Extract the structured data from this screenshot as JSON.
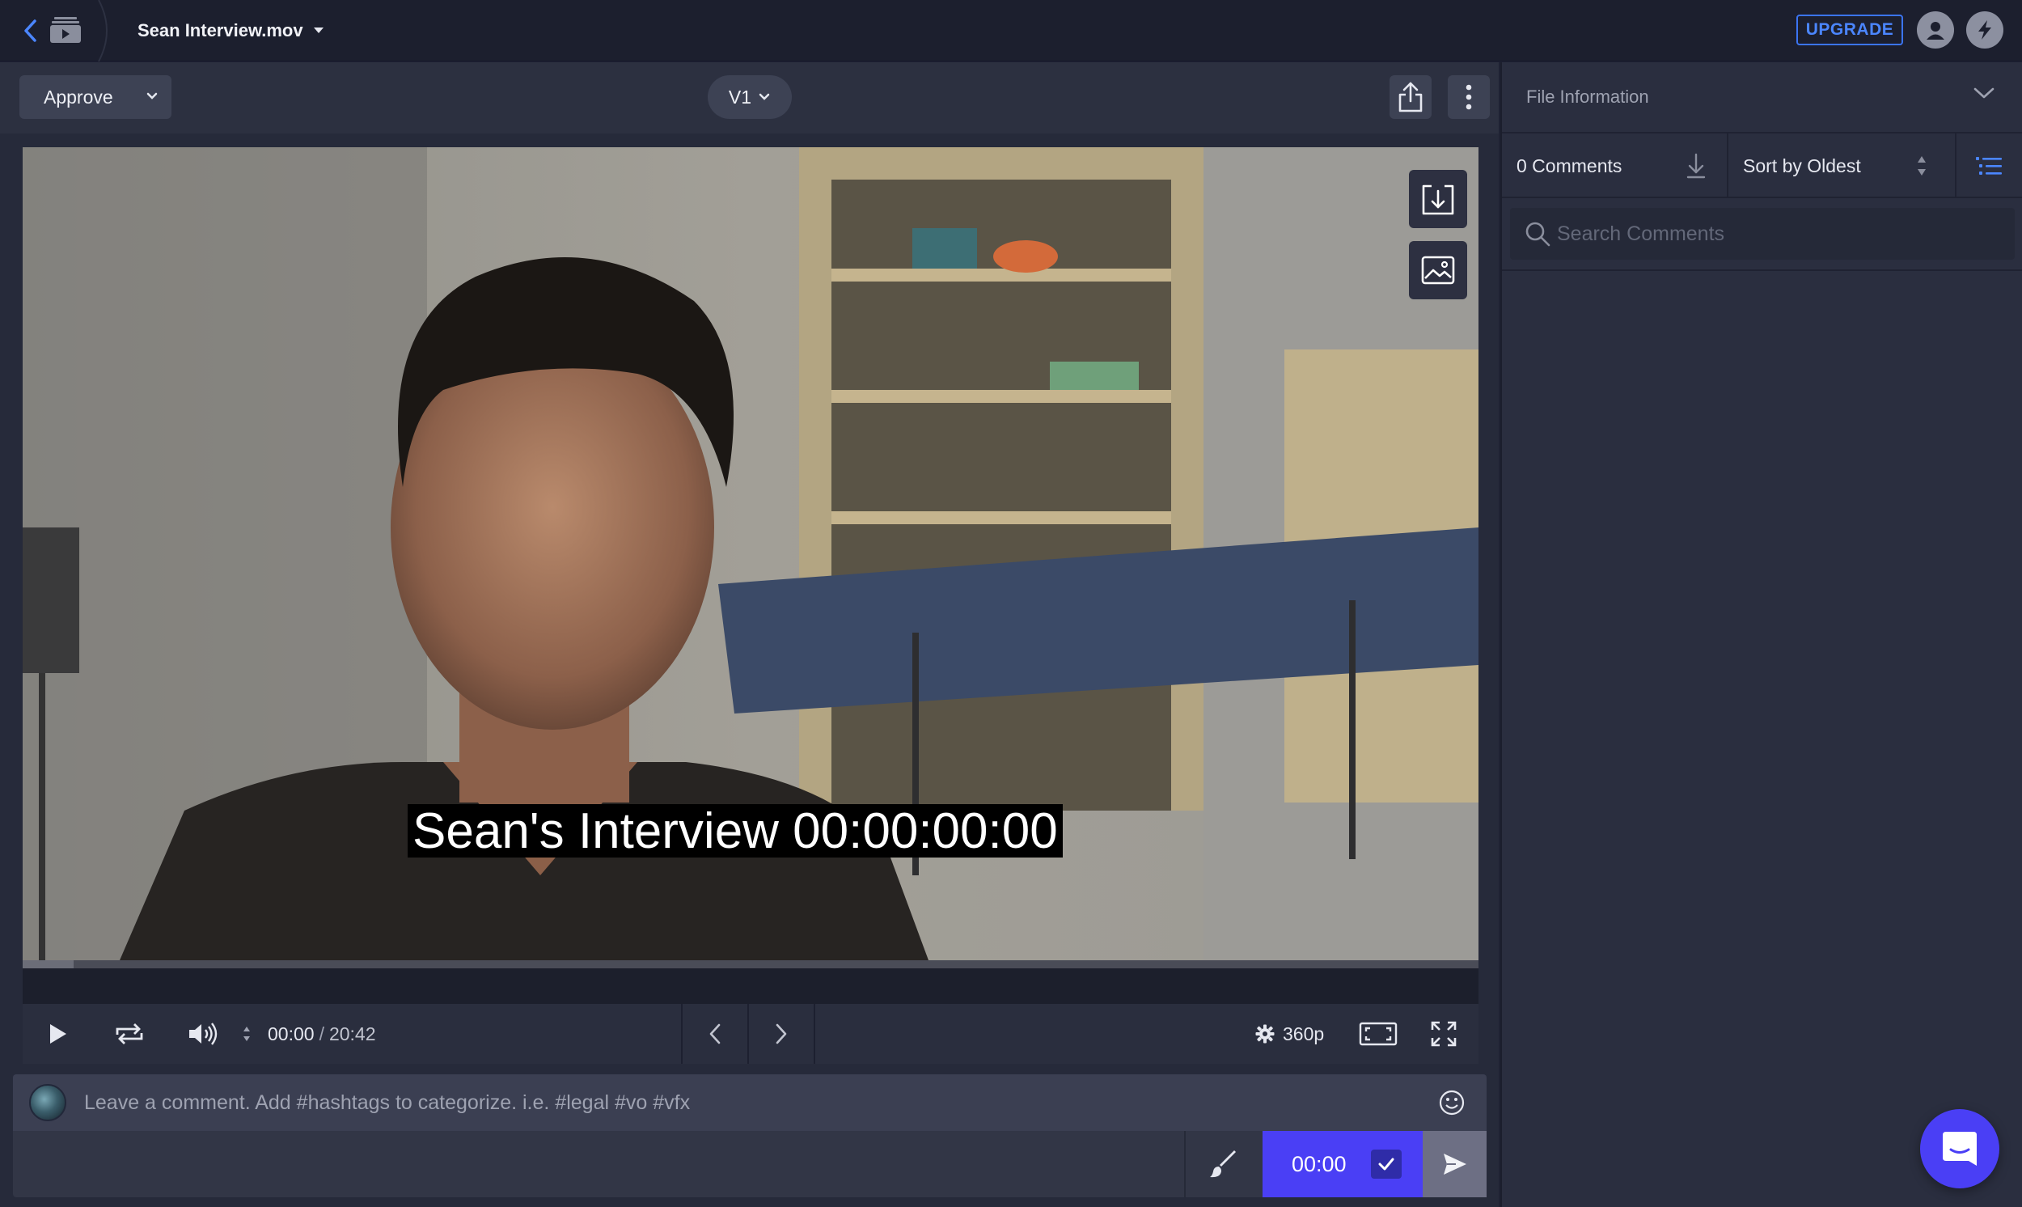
{
  "topbar": {
    "file_name": "Sean Interview.mov",
    "upgrade_label": "UPGRADE"
  },
  "toolbar": {
    "approve_label": "Approve",
    "version_label": "V1"
  },
  "video": {
    "caption": "Sean's Interview 00:00:00:00",
    "playback_progress": 0.035
  },
  "controls": {
    "current_time": "00:00",
    "separator": "/",
    "duration": "20:42",
    "quality": "360p"
  },
  "composer": {
    "placeholder": "Leave a comment. Add #hashtags to categorize. i.e. #legal #vo #vfx",
    "timestamp": "00:00"
  },
  "sidebar": {
    "file_info_label": "File Information",
    "comment_count": "0 Comments",
    "sort_label": "Sort by Oldest",
    "search_placeholder": "Search Comments"
  },
  "colors": {
    "accent": "#4a3ff5",
    "upgrade": "#3b74f2",
    "panel": "#2a2e3f"
  },
  "icons": [
    "back-arrow-icon",
    "folder-play-icon",
    "user-icon",
    "lightning-icon",
    "chevron-down-icon",
    "share-icon",
    "kebab-icon",
    "download-frame-icon",
    "image-icon",
    "play-icon",
    "loop-icon",
    "volume-icon",
    "prev-frame-icon",
    "next-frame-icon",
    "gear-icon",
    "aspect-icon",
    "fullscreen-icon",
    "emoji-icon",
    "brush-icon",
    "check-icon",
    "send-icon",
    "download-icon",
    "sort-arrows-icon",
    "list-view-icon",
    "search-icon",
    "chat-icon"
  ]
}
